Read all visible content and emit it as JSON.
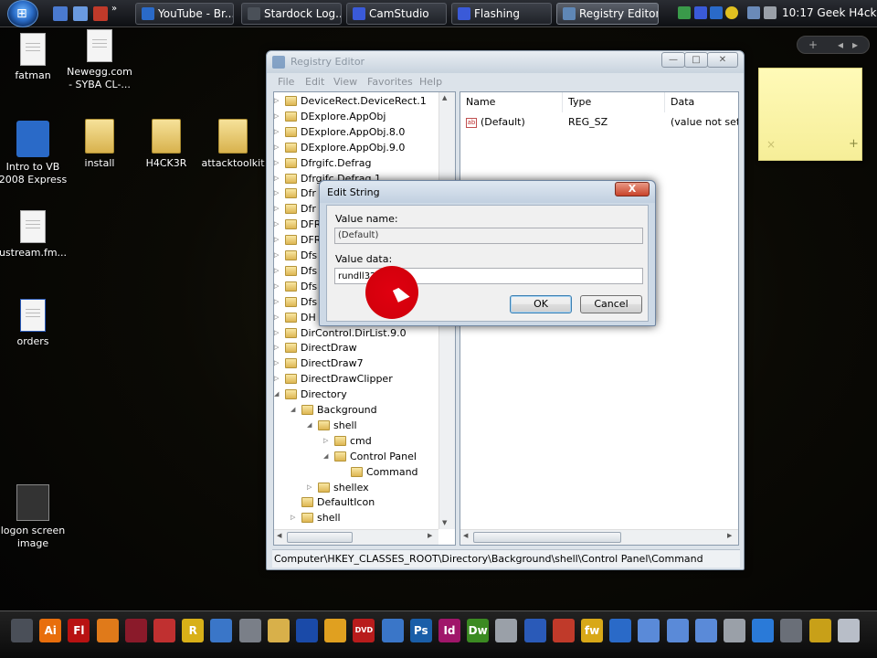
{
  "taskbar": {
    "tasks": [
      {
        "label": "YouTube - Br...",
        "icon": "ie-icon"
      },
      {
        "label": "Stardock Log...",
        "icon": "stardock-icon"
      },
      {
        "label": "CamStudio",
        "icon": "camstudio-icon"
      },
      {
        "label": "Flashing",
        "icon": "flashing-icon"
      },
      {
        "label": "Registry Editor",
        "icon": "regedit-icon"
      }
    ],
    "clock": "10:17 Geek H4ck3r"
  },
  "desktop_icons": [
    {
      "label": "fatman",
      "icon": "document-icon"
    },
    {
      "label": "Newegg.com - SYBA CL-...",
      "icon": "shortcut-icon"
    },
    {
      "label": "Intro to VB 2008 Express",
      "icon": "vb-setup-icon"
    },
    {
      "label": "install",
      "icon": "folder-icon"
    },
    {
      "label": "H4CK3R",
      "icon": "folder-icon"
    },
    {
      "label": "attacktoolkit",
      "icon": "folder-icon"
    },
    {
      "label": "ustream.fm...",
      "icon": "web-document-icon"
    },
    {
      "label": "orders",
      "icon": "word-document-icon"
    },
    {
      "label": "logon screen image",
      "icon": "image-icon"
    }
  ],
  "sidebar": {
    "add": "+",
    "prev": "◂",
    "next": "▸"
  },
  "sticky_note": {
    "close": "×",
    "add": "+"
  },
  "regedit": {
    "title": "Registry Editor",
    "menu": [
      "File",
      "Edit",
      "View",
      "Favorites",
      "Help"
    ],
    "tree": [
      {
        "label": "DeviceRect.DeviceRect.1",
        "level": 0,
        "exp": "▷"
      },
      {
        "label": "DExplore.AppObj",
        "level": 0,
        "exp": "▷"
      },
      {
        "label": "DExplore.AppObj.8.0",
        "level": 0,
        "exp": "▷"
      },
      {
        "label": "DExplore.AppObj.9.0",
        "level": 0,
        "exp": "▷"
      },
      {
        "label": "Dfrgifc.Defrag",
        "level": 0,
        "exp": "▷"
      },
      {
        "label": "Dfrgifc.Defrag.1",
        "level": 0,
        "exp": "▷"
      },
      {
        "label": "Dfr",
        "level": 0,
        "exp": "▷"
      },
      {
        "label": "Dfr",
        "level": 0,
        "exp": "▷"
      },
      {
        "label": "DFR",
        "level": 0,
        "exp": "▷"
      },
      {
        "label": "DFR",
        "level": 0,
        "exp": "▷"
      },
      {
        "label": "Dfs",
        "level": 0,
        "exp": "▷"
      },
      {
        "label": "Dfs",
        "level": 0,
        "exp": "▷"
      },
      {
        "label": "Dfs",
        "level": 0,
        "exp": "▷"
      },
      {
        "label": "Dfs",
        "level": 0,
        "exp": "▷"
      },
      {
        "label": "DH",
        "level": 0,
        "exp": "▷"
      },
      {
        "label": "DirControl.DirList.9.0",
        "level": 0,
        "exp": "▷"
      },
      {
        "label": "DirectDraw",
        "level": 0,
        "exp": "▷"
      },
      {
        "label": "DirectDraw7",
        "level": 0,
        "exp": "▷"
      },
      {
        "label": "DirectDrawClipper",
        "level": 0,
        "exp": "▷"
      },
      {
        "label": "Directory",
        "level": 0,
        "exp": "◢"
      },
      {
        "label": "Background",
        "level": 1,
        "exp": "◢"
      },
      {
        "label": "shell",
        "level": 2,
        "exp": "◢"
      },
      {
        "label": "cmd",
        "level": 3,
        "exp": "▷"
      },
      {
        "label": "Control Panel",
        "level": 3,
        "exp": "◢"
      },
      {
        "label": "Command",
        "level": 4,
        "exp": ""
      },
      {
        "label": "shellex",
        "level": 2,
        "exp": "▷"
      },
      {
        "label": "DefaultIcon",
        "level": 1,
        "exp": ""
      },
      {
        "label": "shell",
        "level": 1,
        "exp": "▷"
      }
    ],
    "columns": [
      "Name",
      "Type",
      "Data"
    ],
    "rows": [
      {
        "name": "(Default)",
        "type": "REG_SZ",
        "data": "(value not set)"
      }
    ],
    "status_path": "Computer\\HKEY_CLASSES_ROOT\\Directory\\Background\\shell\\Control Panel\\Command"
  },
  "dialog": {
    "title": "Edit String",
    "close": "X",
    "value_name_label": "Value name:",
    "value_name": "(Default)",
    "value_data_label": "Value data:",
    "value_data": "rundll32.exe",
    "ok": "OK",
    "cancel": "Cancel"
  },
  "dock": [
    {
      "icon": "explorer-icon",
      "text": "",
      "color": "#4a4f58"
    },
    {
      "icon": "illustrator-icon",
      "text": "Ai",
      "color": "#e86e0c"
    },
    {
      "icon": "flash-icon",
      "text": "Fl",
      "color": "#b81212"
    },
    {
      "icon": "firefox-icon",
      "text": "",
      "color": "#e07a1a"
    },
    {
      "icon": "book-icon",
      "text": "",
      "color": "#8a1a2a"
    },
    {
      "icon": "notes-icon",
      "text": "",
      "color": "#c03030"
    },
    {
      "icon": "rosetta-icon",
      "text": "R",
      "color": "#d8b018"
    },
    {
      "icon": "globe-icon",
      "text": "",
      "color": "#3a76c8"
    },
    {
      "icon": "speaker-icon",
      "text": "",
      "color": "#7a7f88"
    },
    {
      "icon": "folder-icon",
      "text": "",
      "color": "#d8b04a"
    },
    {
      "icon": "network-icon",
      "text": "",
      "color": "#1a4aa8"
    },
    {
      "icon": "mushroom-icon",
      "text": "",
      "color": "#e0a020"
    },
    {
      "icon": "convert-dvd-icon",
      "text": "DVD",
      "color": "#b81c1c"
    },
    {
      "icon": "monitor-icon",
      "text": "",
      "color": "#3a76c8"
    },
    {
      "icon": "photoshop-icon",
      "text": "Ps",
      "color": "#1a5ea8"
    },
    {
      "icon": "indesign-icon",
      "text": "Id",
      "color": "#a0166a"
    },
    {
      "icon": "dreamweaver-icon",
      "text": "Dw",
      "color": "#3b8a22"
    },
    {
      "icon": "webcam-icon",
      "text": "",
      "color": "#9aa0a8"
    },
    {
      "icon": "docs-icon",
      "text": "",
      "color": "#2a5ab8"
    },
    {
      "icon": "tools-icon",
      "text": "",
      "color": "#c03a2a"
    },
    {
      "icon": "fw-icon",
      "text": "fw",
      "color": "#d8a818"
    },
    {
      "icon": "ie-icon",
      "text": "",
      "color": "#2a6ac8"
    },
    {
      "icon": "folder-blue-icon",
      "text": "",
      "color": "#5a8ad8"
    },
    {
      "icon": "folder-blue-icon",
      "text": "",
      "color": "#5a8ad8"
    },
    {
      "icon": "folder-blue-icon",
      "text": "",
      "color": "#5a8ad8"
    },
    {
      "icon": "pen-icon",
      "text": "",
      "color": "#9aa0a8"
    },
    {
      "icon": "earth-icon",
      "text": "",
      "color": "#2a7ad8"
    },
    {
      "icon": "joystick-icon",
      "text": "",
      "color": "#6a6f78"
    },
    {
      "icon": "wand-icon",
      "text": "",
      "color": "#c8a018"
    },
    {
      "icon": "trash-icon",
      "text": "",
      "color": "#b8bec8"
    }
  ],
  "colors": {
    "titlebar": "#c8d3de",
    "dialog_close": "#c8432a",
    "highlight": "#d4000c"
  }
}
